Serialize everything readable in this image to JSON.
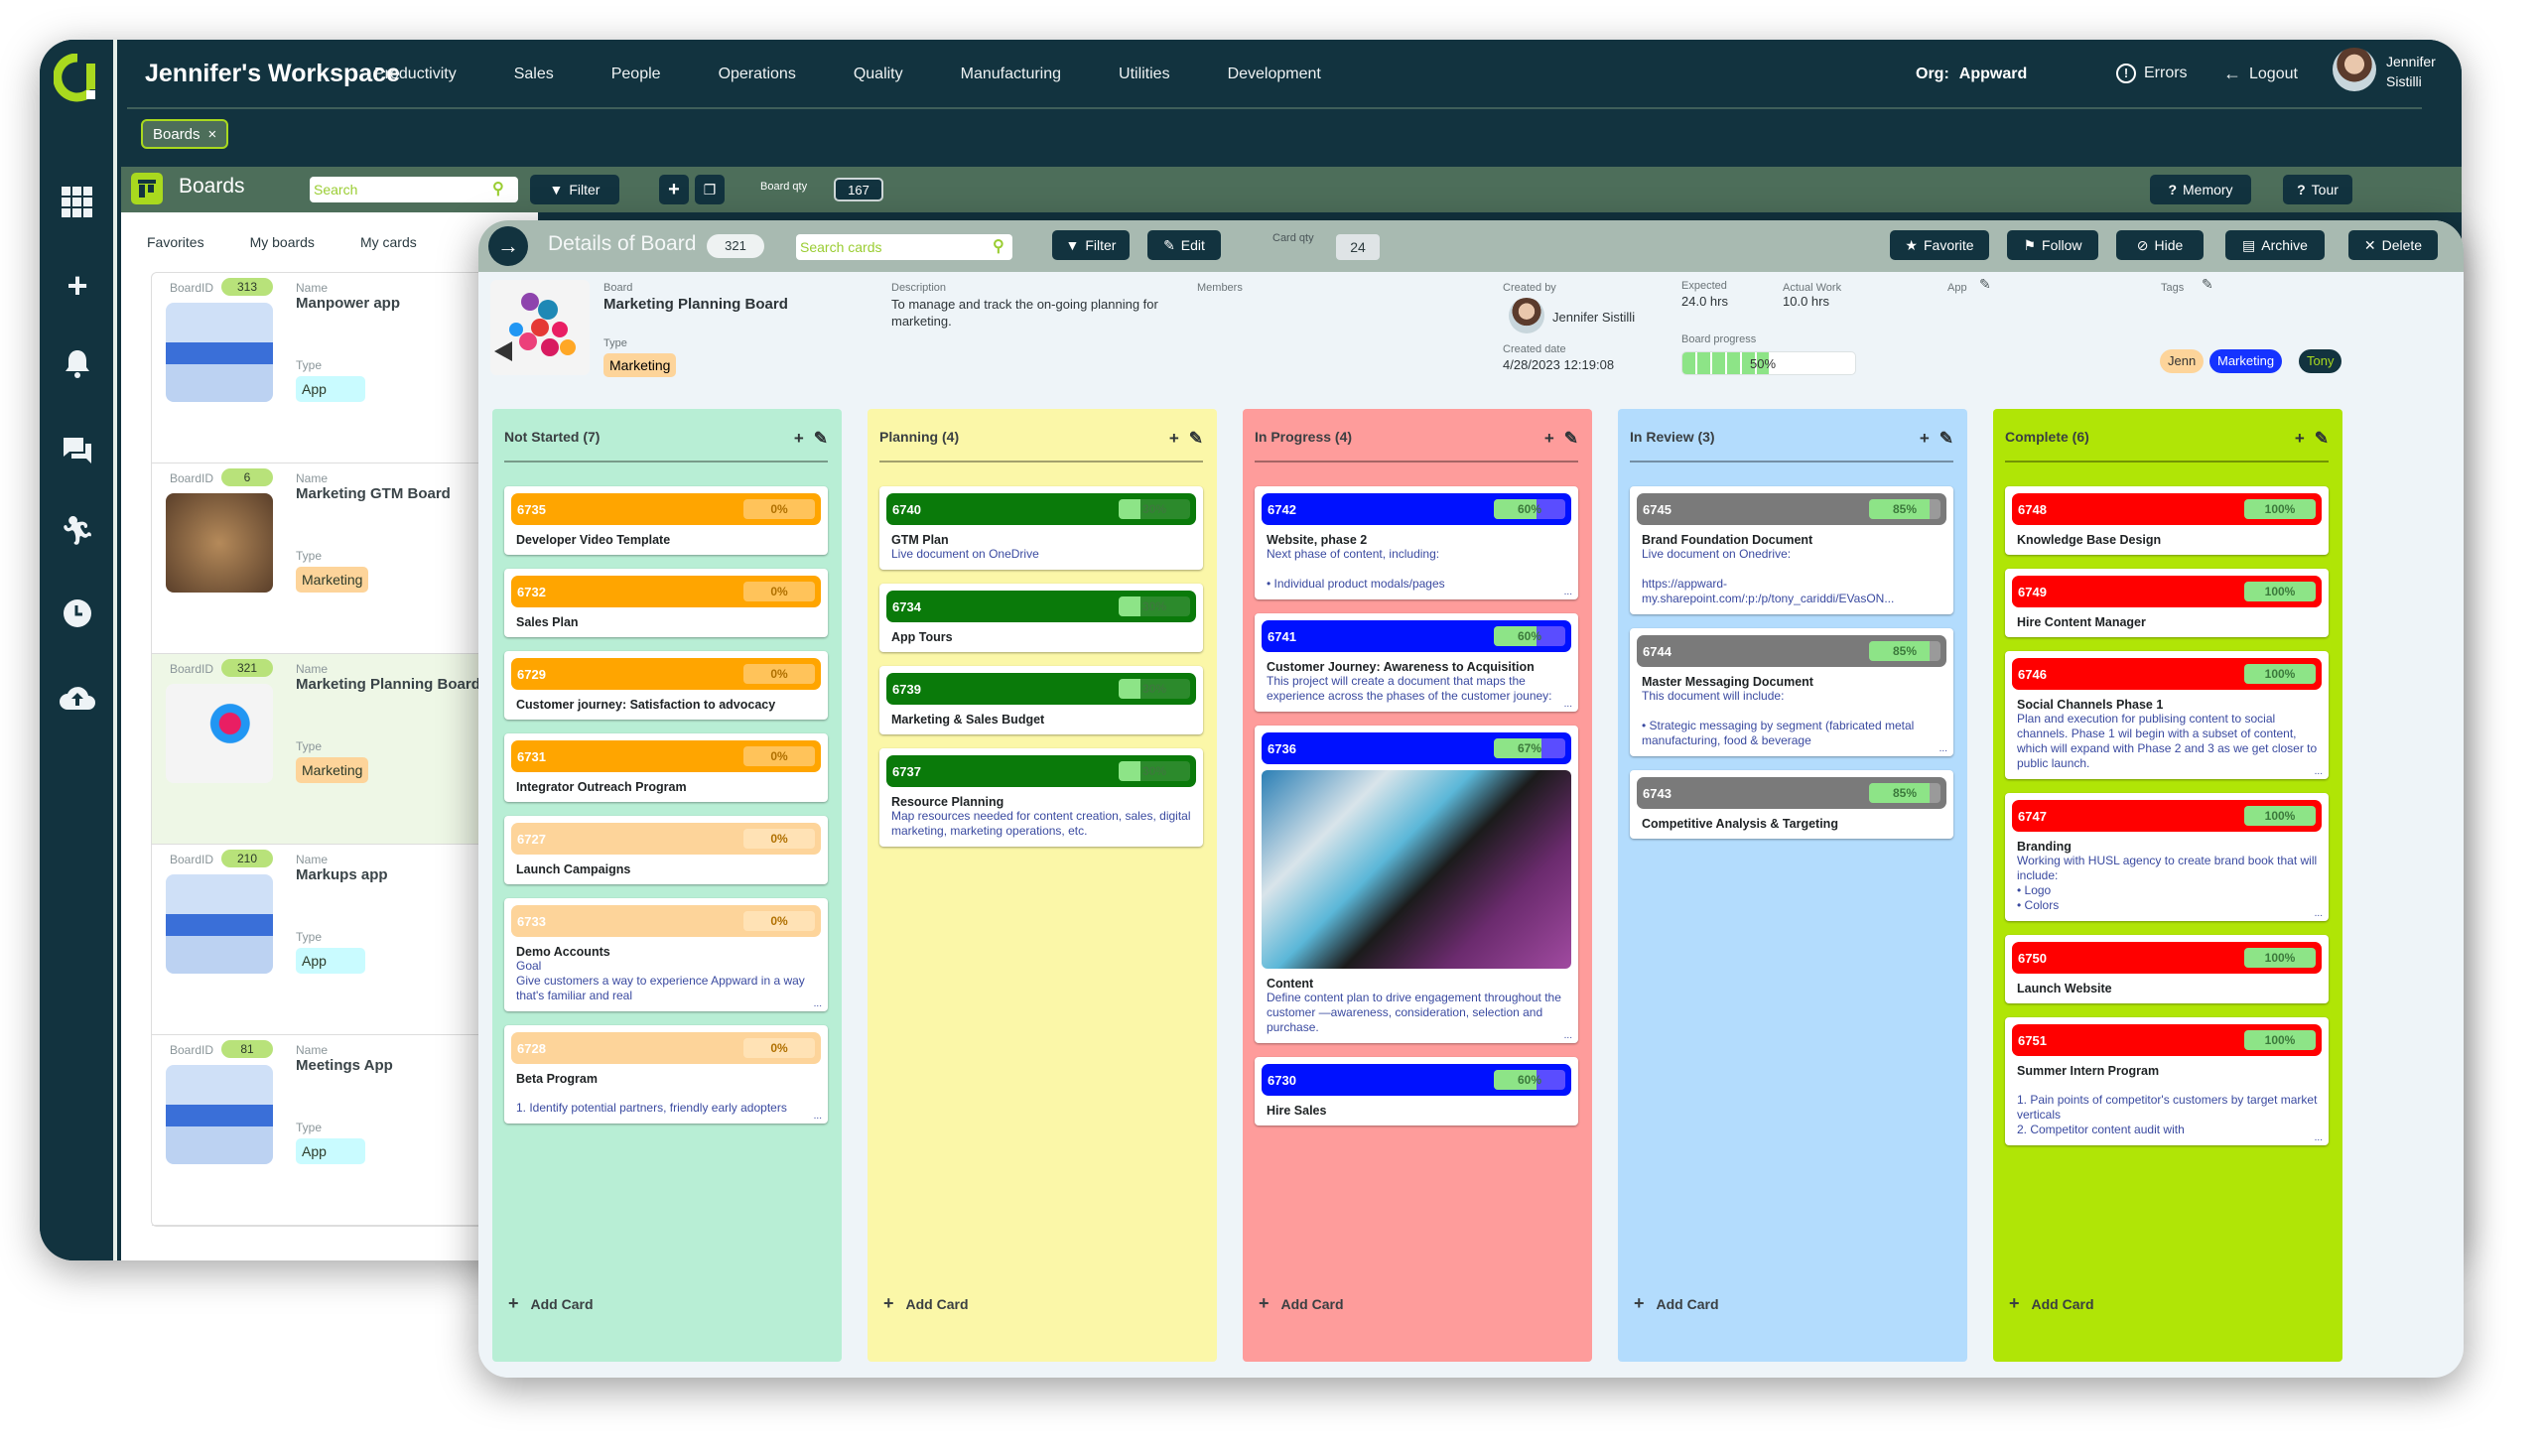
{
  "app": {
    "workspace_title": "Jennifer's Workspace",
    "nav": [
      "Productivity",
      "Sales",
      "People",
      "Operations",
      "Quality",
      "Manufacturing",
      "Utilities",
      "Development"
    ],
    "org_label": "Org:",
    "org_name": "Appward",
    "errors_label": "Errors",
    "logout_label": "Logout",
    "user_first": "Jennifer",
    "user_last": "Sistilli",
    "open_tab": "Boards",
    "open_tab_close": "×"
  },
  "rail_icons": [
    "apps-grid-icon",
    "plus-icon",
    "bell-icon",
    "chat-icon",
    "running-icon",
    "clock-icon",
    "cloud-upload-icon"
  ],
  "boards_bar": {
    "title": "Boards",
    "search_placeholder": "Search",
    "filter_label": "Filter",
    "qty_label": "Board qty",
    "qty": "167",
    "memory_label": "Memory",
    "tour_label": "Tour"
  },
  "left_panel": {
    "tabs": [
      "Favorites",
      "My boards",
      "My cards"
    ],
    "id_label": "BoardID",
    "name_label": "Name",
    "type_label": "Type",
    "boards": [
      {
        "id": "313",
        "name": "Manpower app",
        "type": "App"
      },
      {
        "id": "6",
        "name": "Marketing GTM Board",
        "type": "Marketing"
      },
      {
        "id": "321",
        "name": "Marketing Planning Board",
        "type": "Marketing"
      },
      {
        "id": "210",
        "name": "Markups app",
        "type": "App"
      },
      {
        "id": "81",
        "name": "Meetings App",
        "type": "App"
      }
    ]
  },
  "details": {
    "title": "Details of Board",
    "board_id": "321",
    "search_placeholder": "Search cards",
    "filter_label": "Filter",
    "edit_label": "Edit",
    "card_qty_label": "Card qty",
    "card_qty": "24",
    "actions": [
      "Favorite",
      "Follow",
      "Hide",
      "Archive",
      "Delete"
    ],
    "board_label": "Board",
    "board_name": "Marketing Planning Board",
    "type_label": "Type",
    "type": "Marketing",
    "description_label": "Description",
    "description": "To manage and track the on-going planning for marketing.",
    "members_label": "Members",
    "created_by_label": "Created by",
    "created_by": "Jennifer Sistilli",
    "created_date_label": "Created date",
    "created_date": "4/28/2023 12:19:08",
    "expected_label": "Expected",
    "expected": "24.0  hrs",
    "actual_label": "Actual Work",
    "actual": "10.0 hrs",
    "progress_label": "Board progress",
    "progress_pct": 50,
    "progress_text": "50%",
    "app_label": "App",
    "tags_label": "Tags",
    "tags": [
      {
        "label": "Jenn",
        "bg": "#fdd49a",
        "fg": "#333333"
      },
      {
        "label": "Marketing",
        "bg": "#1533ff",
        "fg": "#ffffff"
      },
      {
        "label": "Tony",
        "bg": "#12333f",
        "fg": "#a9d91e"
      }
    ]
  },
  "add_card_label": "Add Card",
  "columns": [
    {
      "title": "Not Started (7)",
      "bg": "#b8eed5",
      "cards": [
        {
          "id": "6735",
          "pct": 0,
          "pct_text": "0%",
          "bar": "#ffa500",
          "title": "Developer Video Template",
          "desc": ""
        },
        {
          "id": "6732",
          "pct": 0,
          "pct_text": "0%",
          "bar": "#ffa500",
          "title": "Sales Plan",
          "desc": ""
        },
        {
          "id": "6729",
          "pct": 0,
          "pct_text": "0%",
          "bar": "#ffa500",
          "title": "Customer journey: Satisfaction to advocacy",
          "desc": ""
        },
        {
          "id": "6731",
          "pct": 0,
          "pct_text": "0%",
          "bar": "#ffa500",
          "title": "Integrator Outreach Program",
          "desc": ""
        },
        {
          "id": "6727",
          "pct": 0,
          "pct_text": "0%",
          "bar": "#fdd49a",
          "title": "Launch Campaigns",
          "desc": ""
        },
        {
          "id": "6733",
          "pct": 0,
          "pct_text": "0%",
          "bar": "#fdd49a",
          "title": "Demo Accounts",
          "desc": "Goal\nGive customers a way to experience Appward in a way that's familiar and real",
          "more": "..."
        },
        {
          "id": "6728",
          "pct": 0,
          "pct_text": "0%",
          "bar": "#fdd49a",
          "title": "Beta Program",
          "desc": "\n1. Identify potential partners, friendly early adopters",
          "more": "..."
        }
      ]
    },
    {
      "title": "Planning (4)",
      "bg": "#fbf7a8",
      "cards": [
        {
          "id": "6740",
          "pct": 30,
          "pct_text": "30%",
          "bar": "#0a7a0a",
          "title": "GTM Plan",
          "desc": "Live document on OneDrive\n "
        },
        {
          "id": "6734",
          "pct": 30,
          "pct_text": "30%",
          "bar": "#0a7a0a",
          "title": "App Tours",
          "desc": ""
        },
        {
          "id": "6739",
          "pct": 30,
          "pct_text": "30%",
          "bar": "#0a7a0a",
          "title": "Marketing & Sales Budget",
          "desc": ""
        },
        {
          "id": "6737",
          "pct": 30,
          "pct_text": "30%",
          "bar": "#0a7a0a",
          "title": "Resource Planning",
          "desc": "Map resources needed for content creation, sales, digital marketing, marketing operations, etc."
        }
      ]
    },
    {
      "title": "In Progress (4)",
      "bg": "#fe9c9b",
      "cards": [
        {
          "id": "6742",
          "pct": 60,
          "pct_text": "60%",
          "bar": "#0011ff",
          "title": "Website, phase 2",
          "desc": "Next phase of content, including:\n\n• Individual product modals/pages",
          "more": "..."
        },
        {
          "id": "6741",
          "pct": 60,
          "pct_text": "60%",
          "bar": "#0011ff",
          "title": "Customer Journey: Awareness to Acquisition",
          "desc": "This project will create a document that maps the experience across the phases of the customer jouney:",
          "more": "..."
        },
        {
          "id": "6736",
          "pct": 67,
          "pct_text": "67%",
          "bar": "#0011ff",
          "title": "Content",
          "desc": "Define content plan to drive engagement throughout the customer —awareness, consideration, selection and purchase.",
          "more": "...",
          "image": true
        },
        {
          "id": "6730",
          "pct": 60,
          "pct_text": "60%",
          "bar": "#0011ff",
          "title": "Hire Sales",
          "desc": ""
        }
      ]
    },
    {
      "title": "In Review (3)",
      "bg": "#b3dcfd",
      "cards": [
        {
          "id": "6745",
          "pct": 85,
          "pct_text": "85%",
          "bar": "#7a7a7a",
          "title": "Brand Foundation Document",
          "desc": "Live document on Onedrive:\n\nhttps://appward-my.sharepoint.com/:p:/p/tony_cariddi/EVasON..."
        },
        {
          "id": "6744",
          "pct": 85,
          "pct_text": "85%",
          "bar": "#7a7a7a",
          "title": "Master Messaging Document",
          "desc": "This document will include:\n\n• Strategic messaging by segment (fabricated metal manufacturing, food & beverage",
          "more": "..."
        },
        {
          "id": "6743",
          "pct": 85,
          "pct_text": "85%",
          "bar": "#7a7a7a",
          "title": "Competitive Analysis & Targeting",
          "desc": ""
        }
      ]
    },
    {
      "title": "Complete (6)",
      "bg": "#b0e506",
      "cards": [
        {
          "id": "6748",
          "pct": 100,
          "pct_text": "100%",
          "bar": "#ff0000",
          "title": "Knowledge Base Design",
          "desc": ""
        },
        {
          "id": "6749",
          "pct": 100,
          "pct_text": "100%",
          "bar": "#ff0000",
          "title": "Hire Content Manager",
          "desc": ""
        },
        {
          "id": "6746",
          "pct": 100,
          "pct_text": "100%",
          "bar": "#ff0000",
          "title": "Social Channels Phase 1",
          "desc": "Plan and execution for publising content to social channels. Phase 1 wil begin with a subset of content, which will expand with Phase 2 and 3 as we get closer to public launch.",
          "more": "..."
        },
        {
          "id": "6747",
          "pct": 100,
          "pct_text": "100%",
          "bar": "#ff0000",
          "title": "Branding",
          "desc": "Working with HUSL agency to create brand book that will include:\n• Logo\n• Colors",
          "more": "..."
        },
        {
          "id": "6750",
          "pct": 100,
          "pct_text": "100%",
          "bar": "#ff0000",
          "title": "Launch Website",
          "desc": ""
        },
        {
          "id": "6751",
          "pct": 100,
          "pct_text": "100%",
          "bar": "#ff0000",
          "title": "Summer Intern Program",
          "desc": "\n1. Pain points of competitor's customers by target market verticals\n2. Competitor content audit with",
          "more": "..."
        }
      ]
    }
  ]
}
